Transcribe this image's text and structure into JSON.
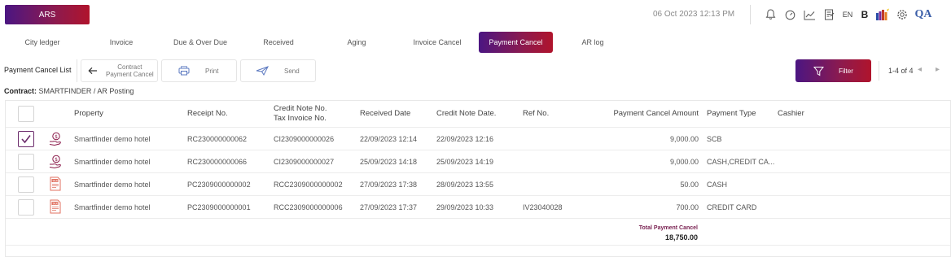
{
  "header": {
    "logo": "ARS",
    "datetime": "06 Oct 2023  12:13 PM",
    "language": "EN",
    "bold_label": "B",
    "qa_label": "QA",
    "icons": [
      "bell-icon",
      "clock-icon",
      "chart-icon",
      "document-icon",
      "color-palette-icon",
      "gear-icon"
    ]
  },
  "tabs": [
    {
      "label": "City ledger",
      "active": false
    },
    {
      "label": "Invoice",
      "active": false
    },
    {
      "label": "Due & Over Due",
      "active": false
    },
    {
      "label": "Received",
      "active": false
    },
    {
      "label": "Aging",
      "active": false
    },
    {
      "label": "Invoice Cancel",
      "active": false
    },
    {
      "label": "Payment Cancel",
      "active": true
    },
    {
      "label": "AR log",
      "active": false
    }
  ],
  "toolbar": {
    "title": "Payment Cancel List",
    "back_line1": "Contract",
    "back_line2": "Payment Cancel",
    "print": "Print",
    "send": "Send",
    "filter": "Filter",
    "pager": "1-4 of 4"
  },
  "contract": {
    "label": "Contract:",
    "value": "SMARTFINDER / AR Posting"
  },
  "table": {
    "headers": {
      "property": "Property",
      "receipt": "Receipt No.",
      "credit_note_1": "Credit Note No.",
      "credit_note_2": "Tax Invoice No.",
      "received_date": "Received Date",
      "credit_note_date": "Credit Note Date.",
      "ref": "Ref No.",
      "amount": "Payment Cancel Amount",
      "payment_type": "Payment Type",
      "cashier": "Cashier"
    },
    "rows": [
      {
        "checked": true,
        "icon": "money-hand-icon",
        "property": "Smartfinder demo hotel",
        "receipt": "RC230000000062",
        "credit_note": "CI2309000000026",
        "received_date": "22/09/2023 12:14",
        "credit_note_date": "22/09/2023 12:16",
        "ref": "",
        "amount": "9,000.00",
        "payment_type": "SCB",
        "cashier": ""
      },
      {
        "checked": false,
        "icon": "money-hand-icon",
        "property": "Smartfinder demo hotel",
        "receipt": "RC230000000066",
        "credit_note": "CI2309000000027",
        "received_date": "25/09/2023 14:18",
        "credit_note_date": "25/09/2023 14:19",
        "ref": "",
        "amount": "9,000.00",
        "payment_type": "CASH,CREDIT CA...",
        "cashier": ""
      },
      {
        "checked": false,
        "icon": "tax-document-icon",
        "property": "Smartfinder demo hotel",
        "receipt": "PC2309000000002",
        "credit_note": "RCC2309000000002",
        "received_date": "27/09/2023 17:38",
        "credit_note_date": "28/09/2023 13:55",
        "ref": "",
        "amount": "50.00",
        "payment_type": "CASH",
        "cashier": ""
      },
      {
        "checked": false,
        "icon": "tax-document-icon",
        "property": "Smartfinder demo hotel",
        "receipt": "PC2309000000001",
        "credit_note": "RCC2309000000006",
        "received_date": "27/09/2023 17:37",
        "credit_note_date": "29/09/2023 10:33",
        "ref": "IV23040028",
        "amount": "700.00",
        "payment_type": "CREDIT CARD",
        "cashier": ""
      }
    ],
    "total_label": "Total Payment Cancel",
    "total_value": "18,750.00"
  },
  "colors": {
    "brand_start": "#4b1682",
    "brand_end": "#b0142c",
    "total_label": "#7a2252"
  }
}
